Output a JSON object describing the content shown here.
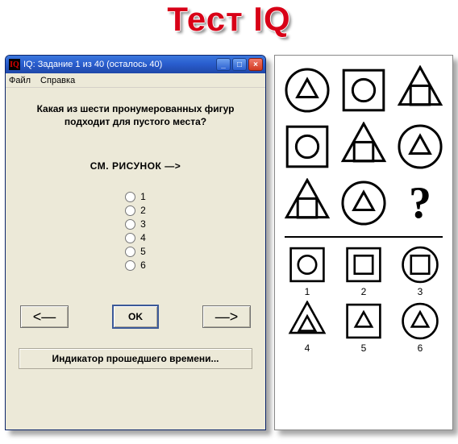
{
  "page_heading": "Тест IQ",
  "window": {
    "title": "IQ: Задание 1 из 40   (осталось 40)",
    "menu": {
      "file": "Файл",
      "help": "Справка"
    },
    "question": "Какая из шести пронумерованных фигур подходит для пустого места?",
    "see_figure": "СМ. РИСУНОК  —>",
    "options": [
      "1",
      "2",
      "3",
      "4",
      "5",
      "6"
    ],
    "btn_prev": "<—",
    "btn_ok": "OK",
    "btn_next": "—>",
    "timer_label": "Индикатор прошедшего времени...",
    "win_min": "_",
    "win_max": "□",
    "win_close": "×"
  },
  "figure": {
    "matrix": [
      {
        "outer": "circle",
        "inner": "triangle"
      },
      {
        "outer": "square",
        "inner": "circle"
      },
      {
        "outer": "triangle",
        "inner": "square"
      },
      {
        "outer": "square",
        "inner": "circle"
      },
      {
        "outer": "triangle",
        "inner": "square"
      },
      {
        "outer": "circle",
        "inner": "triangle"
      },
      {
        "outer": "triangle",
        "inner": "square"
      },
      {
        "outer": "circle",
        "inner": "triangle"
      },
      {
        "outer": "question"
      }
    ],
    "answers": [
      {
        "n": "1",
        "outer": "square",
        "inner": "circle"
      },
      {
        "n": "2",
        "outer": "square",
        "inner": "square"
      },
      {
        "n": "3",
        "outer": "circle",
        "inner": "square"
      },
      {
        "n": "4",
        "outer": "triangle",
        "inner": "triangle"
      },
      {
        "n": "5",
        "outer": "square",
        "inner": "triangle"
      },
      {
        "n": "6",
        "outer": "circle",
        "inner": "triangle"
      }
    ],
    "question_mark": "?"
  }
}
